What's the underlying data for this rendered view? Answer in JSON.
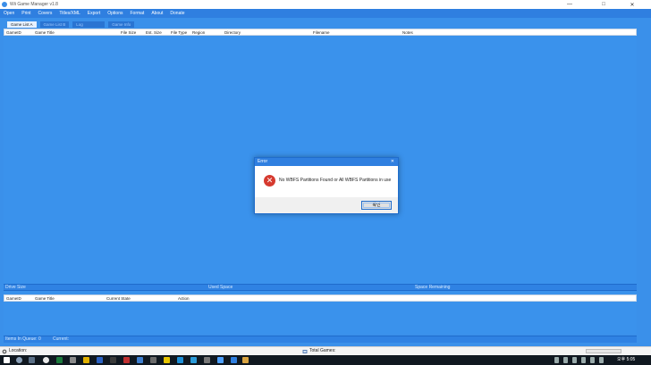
{
  "window": {
    "title": "Wii Game Manager v1.8",
    "minimize": "—",
    "maximize": "□",
    "close": "✕"
  },
  "menu": [
    "Open",
    "Print",
    "Covers",
    "Titles/XML",
    "Export",
    "Options",
    "Format",
    "About",
    "Donate"
  ],
  "tabs": [
    {
      "label": "Game List A",
      "active": true
    },
    {
      "label": "Game List B",
      "active": false
    },
    {
      "label": "Log",
      "active": false
    },
    {
      "label": "Game Info",
      "active": false
    }
  ],
  "game_list": {
    "columns": [
      "GameID",
      "Game Title",
      "File Size",
      "Est. Size",
      "File Type",
      "Region",
      "Directory",
      "Filename",
      "Notes"
    ]
  },
  "drive_info": {
    "drive_size": "Drive Size",
    "used_space": "Used Space",
    "space_remaining": "Space Remaining"
  },
  "queue": {
    "columns": [
      "GameID",
      "Game Title",
      "Current State",
      "Action"
    ],
    "items_in_queue": "Items In Queue: 0",
    "current": "Current:"
  },
  "statusbar": {
    "location": "Location:",
    "total_games": "Total Games:"
  },
  "taskbar": {
    "clock": "오후 5:05"
  },
  "dialog": {
    "title": "Error",
    "close": "✕",
    "message": "No WBFS Partitions Found or All WBFS Partitions in use",
    "ok": "확인",
    "icon": "error-x-icon"
  },
  "colors": {
    "accent": "#2f7fe0",
    "background": "#3a90ea",
    "error": "#d63a2f"
  }
}
